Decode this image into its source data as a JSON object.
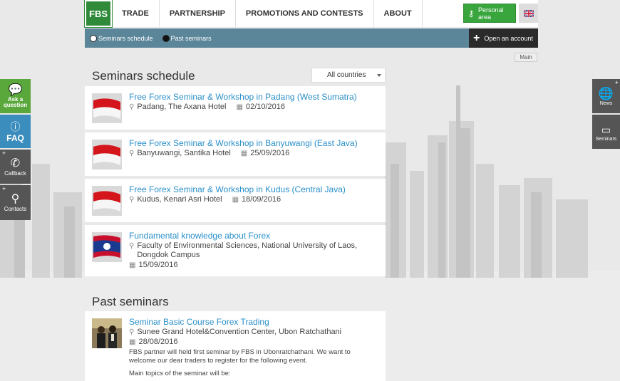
{
  "nav": {
    "logo": "FBS",
    "items": [
      "TRADE",
      "PARTNERSHIP",
      "PROMOTIONS AND CONTESTS",
      "ABOUT"
    ],
    "personal_area": "Personal area"
  },
  "subnav": {
    "schedule_label": "Seminars schedule",
    "past_label": "Past seminars",
    "open_account": "Open an account"
  },
  "main_tag": "Main",
  "schedule": {
    "title": "Seminars schedule",
    "country_filter": "All countries",
    "items": [
      {
        "title": "Free Forex Seminar & Workshop in Padang (West Sumatra)",
        "place": "Padang, The Axana Hotel",
        "date": "02/10/2016",
        "flag": "indonesia"
      },
      {
        "title": "Free Forex Seminar & Workshop in Banyuwangi (East Java)",
        "place": "Banyuwangi, Santika Hotel",
        "date": "25/09/2016",
        "flag": "indonesia"
      },
      {
        "title": "Free Forex Seminar & Workshop in Kudus (Central Java)",
        "place": "Kudus, Kenari Asri Hotel",
        "date": "18/09/2016",
        "flag": "indonesia"
      },
      {
        "title": "Fundamental knowledge about Forex",
        "place": "Faculty of Environmental Sciences, National University of Laos, Dongdok Campus",
        "date": "15/09/2016",
        "flag": "laos"
      }
    ]
  },
  "past": {
    "title": "Past seminars",
    "items": [
      {
        "title": "Seminar Basic Course Forex Trading",
        "place": "Sunee Grand Hotel&Convention Center, Ubon Ratchathani",
        "date": "28/08/2016",
        "description": "FBS partner will held first seminar by FBS in Ubonratchathani. We want to welcome our dear traders to register for the following event.",
        "topics_label": "Main topics of the seminar will be:"
      }
    ]
  },
  "left_tabs": [
    "Ask a question",
    "FAQ",
    "Callback",
    "Contacts"
  ],
  "right_tabs": [
    "News",
    "Seminars"
  ],
  "colors": {
    "brand_green": "#2f8a3a",
    "link_blue": "#2a8fc9",
    "subnav_bg": "#5b8599"
  }
}
